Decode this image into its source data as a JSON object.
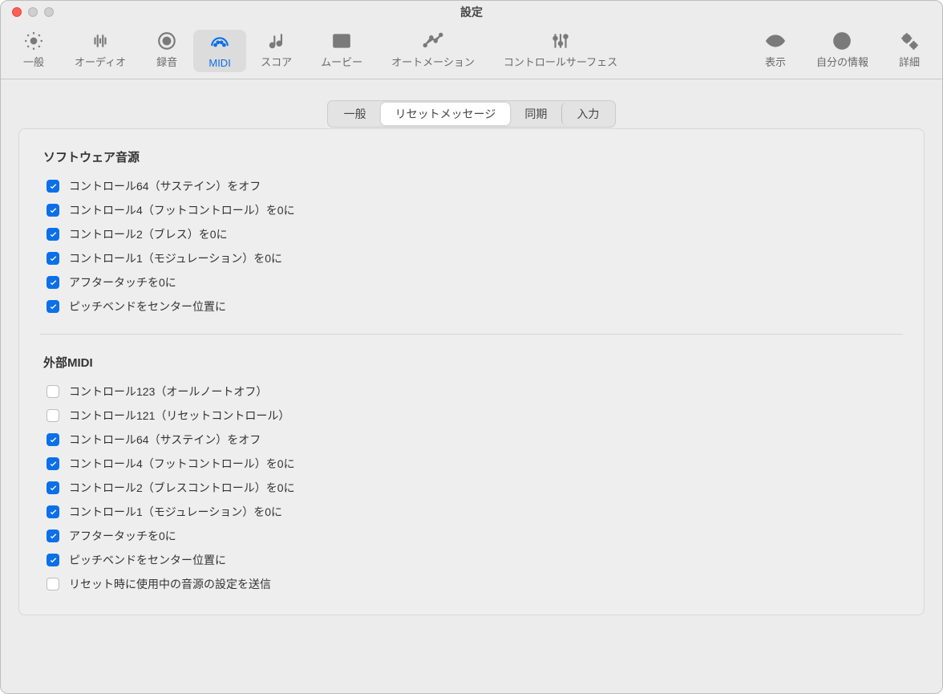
{
  "window": {
    "title": "設定"
  },
  "toolbar": {
    "items": [
      {
        "label": "一般"
      },
      {
        "label": "オーディオ"
      },
      {
        "label": "録音"
      },
      {
        "label": "MIDI"
      },
      {
        "label": "スコア"
      },
      {
        "label": "ムービー"
      },
      {
        "label": "オートメーション"
      },
      {
        "label": "コントロールサーフェス"
      },
      {
        "label": "表示"
      },
      {
        "label": "自分の情報"
      },
      {
        "label": "詳細"
      }
    ],
    "active_index": 3
  },
  "segmented": {
    "items": [
      {
        "label": "一般"
      },
      {
        "label": "リセットメッセージ"
      },
      {
        "label": "同期"
      },
      {
        "label": "入力"
      }
    ],
    "active_index": 1
  },
  "sections": {
    "software_instruments": {
      "title": "ソフトウェア音源",
      "items": [
        {
          "label": "コントロール64（サステイン）をオフ",
          "checked": true
        },
        {
          "label": "コントロール4（フットコントロール）を0に",
          "checked": true
        },
        {
          "label": "コントロール2（ブレス）を0に",
          "checked": true
        },
        {
          "label": "コントロール1（モジュレーション）を0に",
          "checked": true
        },
        {
          "label": "アフタータッチを0に",
          "checked": true
        },
        {
          "label": "ピッチベンドをセンター位置に",
          "checked": true
        }
      ]
    },
    "external_midi": {
      "title": "外部MIDI",
      "items": [
        {
          "label": "コントロール123（オールノートオフ）",
          "checked": false
        },
        {
          "label": "コントロール121（リセットコントロール）",
          "checked": false
        },
        {
          "label": "コントロール64（サステイン）をオフ",
          "checked": true
        },
        {
          "label": "コントロール4（フットコントロール）を0に",
          "checked": true
        },
        {
          "label": "コントロール2（ブレスコントロール）を0に",
          "checked": true
        },
        {
          "label": "コントロール1（モジュレーション）を0に",
          "checked": true
        },
        {
          "label": "アフタータッチを0に",
          "checked": true
        },
        {
          "label": "ピッチベンドをセンター位置に",
          "checked": true
        },
        {
          "label": "リセット時に使用中の音源の設定を送信",
          "checked": false
        }
      ]
    }
  },
  "colors": {
    "accent": "#0b6fe8"
  }
}
